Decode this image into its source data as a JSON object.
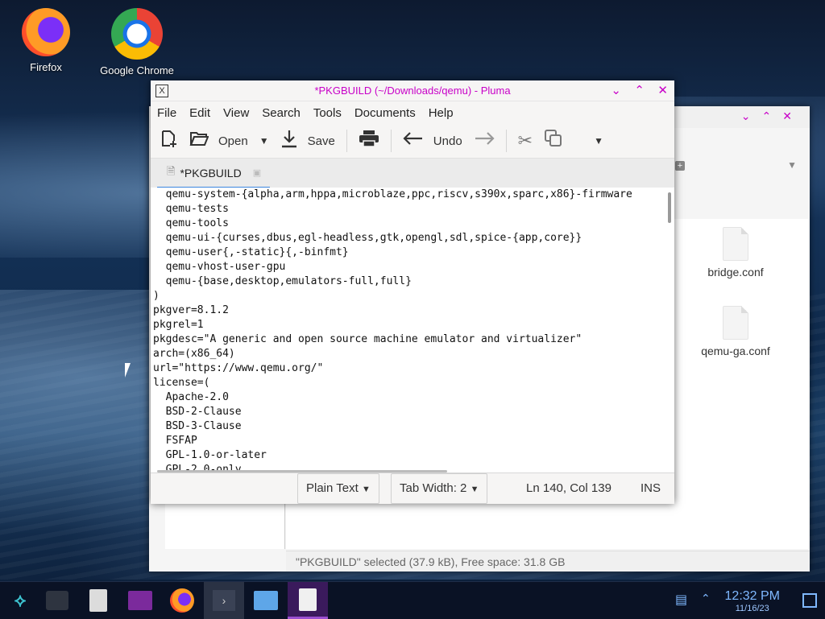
{
  "desktop": {
    "icons": [
      {
        "label": "Firefox"
      },
      {
        "label": "Google Chrome"
      }
    ]
  },
  "file_manager": {
    "files": [
      {
        "name": "bridge.conf"
      },
      {
        "name": "qemu-ga.conf"
      }
    ],
    "status": "\"PKGBUILD\" selected (37.9 kB), Free space: 31.8 GB"
  },
  "editor_window": {
    "title": "*PKGBUILD (~/Downloads/qemu) - Pluma",
    "menu": [
      "File",
      "Edit",
      "View",
      "Search",
      "Tools",
      "Documents",
      "Help"
    ],
    "toolbar": {
      "open_label": "Open",
      "save_label": "Save",
      "undo_label": "Undo"
    },
    "tab_label": "*PKGBUILD",
    "code_lines": [
      "  qemu-system-{alpha,arm,hppa,microblaze,ppc,riscv,s390x,sparc,x86}-firmware",
      "  qemu-tests",
      "  qemu-tools",
      "  qemu-ui-{curses,dbus,egl-headless,gtk,opengl,sdl,spice-{app,core}}",
      "  qemu-user{,-static}{,-binfmt}",
      "  qemu-vhost-user-gpu",
      "  qemu-{base,desktop,emulators-full,full}",
      ")",
      "pkgver=8.1.2",
      "pkgrel=1",
      "pkgdesc=\"A generic and open source machine emulator and virtualizer\"",
      "arch=(x86_64)",
      "url=\"https://www.qemu.org/\"",
      "license=(",
      "  Apache-2.0",
      "  BSD-2-Clause",
      "  BSD-3-Clause",
      "  FSFAP",
      "  GPL-1.0-or-later",
      "  GPL-2.0-only"
    ],
    "status": {
      "language": "Plain Text",
      "tab_width_label": "Tab Width:",
      "tab_width_value": "2",
      "position": "Ln 140, Col 139",
      "mode": "INS"
    }
  },
  "taskbar": {
    "time": "12:32 PM",
    "date": "11/16/23"
  },
  "colors": {
    "title_accent": "#c800c8",
    "tab_underline": "#3b86e0",
    "taskbar_bg": "#0a1225",
    "active_task": "#3a1a5c"
  }
}
